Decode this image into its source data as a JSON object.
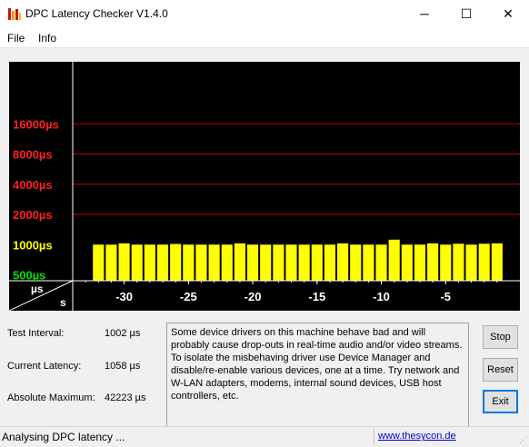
{
  "window": {
    "title": "DPC Latency Checker V1.4.0",
    "icon": "app-bars-icon",
    "controls": {
      "minimize": "─",
      "maximize": "☐",
      "close": "✕"
    }
  },
  "menu": {
    "items": [
      "File",
      "Info"
    ]
  },
  "chart_data": {
    "type": "bar",
    "title": "",
    "xlabel": "s",
    "ylabel": "µs",
    "y_tick_labels": [
      "16000µs",
      "8000µs",
      "4000µs",
      "2000µs",
      "1000µs",
      "500µs"
    ],
    "y_tick_values": [
      16000,
      8000,
      4000,
      2000,
      1000,
      500
    ],
    "y_tick_colors": [
      "#ff2020",
      "#ff2020",
      "#ff2020",
      "#ff2020",
      "#ffff00",
      "#00e000"
    ],
    "gridline_values": [
      16000,
      8000,
      4000,
      2000
    ],
    "x_tick_labels": [
      "-30",
      "-25",
      "-20",
      "-15",
      "-10",
      "-5"
    ],
    "x_tick_values": [
      -30,
      -25,
      -20,
      -15,
      -10,
      -5
    ],
    "x_range": [
      -34,
      0
    ],
    "x": [
      -32,
      -31,
      -30,
      -29,
      -28,
      -27,
      -26,
      -25,
      -24,
      -23,
      -22,
      -21,
      -20,
      -19,
      -18,
      -17,
      -16,
      -15,
      -14,
      -13,
      -12,
      -11,
      -10,
      -9,
      -8,
      -7,
      -6,
      -5,
      -4,
      -3,
      -2,
      -1
    ],
    "values": [
      1000,
      1000,
      1030,
      1000,
      1000,
      1000,
      1015,
      1000,
      1000,
      1000,
      1000,
      1030,
      1000,
      1000,
      1000,
      1000,
      1000,
      1000,
      1000,
      1030,
      1000,
      1000,
      1000,
      1120,
      1000,
      1000,
      1030,
      1000,
      1020,
      1000,
      1020,
      1030
    ],
    "grid": true,
    "bar_color": "#ffff00",
    "background": "#000000",
    "gridline_color": "#c00000"
  },
  "stats": {
    "test_interval": {
      "label": "Test Interval:",
      "value": "1002 µs"
    },
    "current_latency": {
      "label": "Current Latency:",
      "value": "1058 µs"
    },
    "absolute_maximum": {
      "label": "Absolute Maximum:",
      "value": "42223 µs"
    }
  },
  "message": "Some device drivers on this machine behave bad and will probably cause drop-outs in real-time audio and/or video streams. To isolate the misbehaving driver use Device Manager and disable/re-enable various devices, one at a time. Try network and W-LAN adapters, modems, internal sound devices, USB host controllers, etc.",
  "buttons": {
    "stop": "Stop",
    "reset": "Reset",
    "exit": "Exit"
  },
  "status": {
    "text": "Analysing DPC latency ...",
    "link": "www.thesycon.de"
  }
}
